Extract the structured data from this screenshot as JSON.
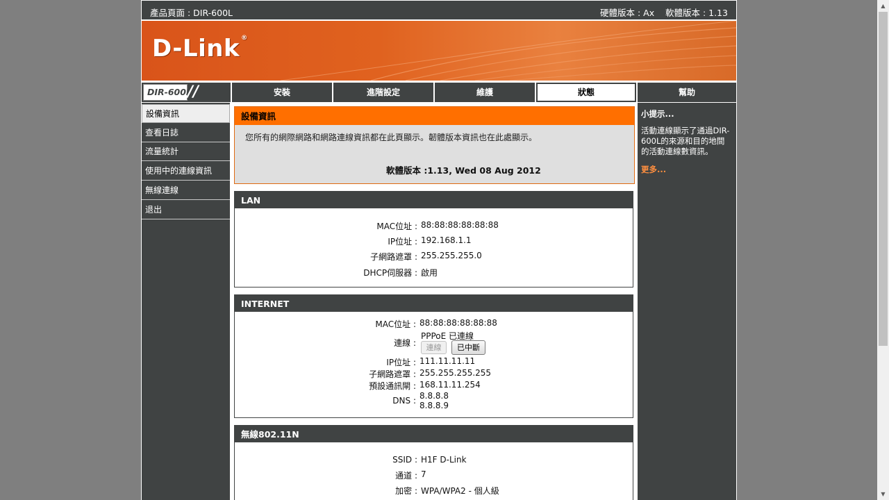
{
  "topbar": {
    "product_page": "產品頁面 : DIR-600L",
    "versions": "硬體版本 : Ax    軟體版本 : 1.13"
  },
  "banner": {
    "logo": "D-Link",
    "registered": "®"
  },
  "nav": {
    "model": "DIR-600L",
    "tabs": [
      {
        "label": "安裝"
      },
      {
        "label": "進階設定"
      },
      {
        "label": "維護"
      },
      {
        "label": "狀態"
      },
      {
        "label": "幫助"
      }
    ]
  },
  "sidebar": {
    "items": [
      {
        "label": "設備資訊"
      },
      {
        "label": "查看日誌"
      },
      {
        "label": "流量統計"
      },
      {
        "label": "使用中的連線資訊"
      },
      {
        "label": "無線連線"
      },
      {
        "label": "退出"
      }
    ]
  },
  "device_info": {
    "title": "設備資訊",
    "description": "您所有的網際網路和網路連線資訊都在此頁顯示。韌體版本資訊也在此處顯示。",
    "firmware_label": "軟體版本 :",
    "firmware_value": "1.13,  Wed 08 Aug 2012"
  },
  "lan": {
    "title": "LAN",
    "mac_label": "MAC位址 :",
    "mac": "88:88:88:88:88:88",
    "ip_label": "IP位址 :",
    "ip": "192.168.1.1",
    "mask_label": "子網路遮罩 :",
    "mask": "255.255.255.0",
    "dhcp_label": "DHCP伺服器 :",
    "dhcp": "啟用"
  },
  "internet": {
    "title": "INTERNET",
    "mac_label": "MAC位址 :",
    "mac": "88:88:88:88:88:88",
    "conn_label": "連線 :",
    "conn_status": "PPPoE 已連線",
    "connect_button": "連線",
    "disconnect_button": "已中斷",
    "ip_label": "IP位址 :",
    "ip": "111.11.11.11",
    "mask_label": "子網路遮罩 :",
    "mask": "255.255.255.255",
    "gateway_label": "預設通訊閘 :",
    "gateway": "168.11.11.254",
    "dns_label": "DNS :",
    "dns1": "8.8.8.8",
    "dns2": "8.8.8.9"
  },
  "wireless": {
    "title": "無線802.11N",
    "ssid_label": "SSID :",
    "ssid": "H1F D-Link",
    "channel_label": "通道 :",
    "channel": "7",
    "enc_label": "加密 :",
    "enc": "WPA/WPA2 - 個人級"
  },
  "hints": {
    "title": "小提示...",
    "body": "活動連線顯示了通過DIR-600L的來源和目的地間的活動連線數資訊。",
    "more": "更多..."
  },
  "colors": {
    "dark": "#404343",
    "orange": "#ff6f00",
    "background": "#7f7f7f"
  }
}
